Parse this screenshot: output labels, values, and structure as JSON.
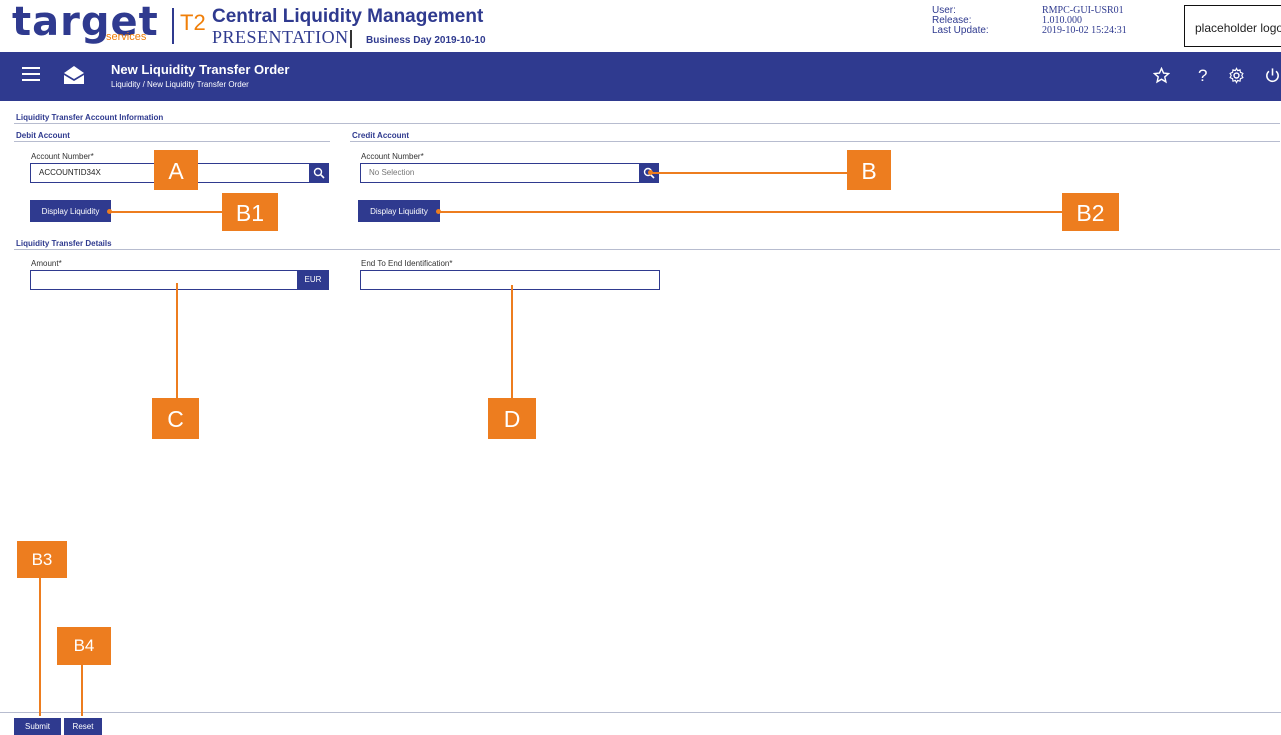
{
  "header": {
    "brand": "target",
    "brand_sub": "services",
    "system": "T2",
    "app_title": "Central Liquidity Management",
    "environment": "PRESENTATION",
    "business_day": "Business Day 2019-10-10",
    "meta": {
      "user_label": "User:",
      "user_value": "RMPC-GUI-USR01",
      "release_label": "Release:",
      "release_value": "1.010.000",
      "update_label": "Last Update:",
      "update_value": "2019-10-02 15:24:31"
    },
    "logo_placeholder": "placeholder logo"
  },
  "nav": {
    "page_title": "New Liquidity Transfer Order",
    "breadcrumb": "Liquidity  /  New Liquidity Transfer Order",
    "icons": [
      "menu-icon",
      "mail-icon",
      "star-icon",
      "help-icon",
      "gear-icon",
      "power-icon"
    ],
    "help_glyph": "?"
  },
  "account_section": {
    "title": "Liquidity Transfer Account Information",
    "debit": {
      "title": "Debit Account",
      "account_label": "Account Number*",
      "account_value": "ACCOUNTID34X",
      "display_button": "Display Liquidity"
    },
    "credit": {
      "title": "Credit Account",
      "account_label": "Account Number*",
      "account_placeholder": "No Selection",
      "display_button": "Display Liquidity"
    }
  },
  "details_section": {
    "title": "Liquidity Transfer Details",
    "amount_label": "Amount*",
    "amount_value": "",
    "currency": "EUR",
    "e2e_label": "End To End Identification*",
    "e2e_value": ""
  },
  "footer": {
    "submit": "Submit",
    "reset": "Reset"
  },
  "annotations": {
    "A": "A",
    "B": "B",
    "B1": "B1",
    "B2": "B2",
    "C": "C",
    "D": "D",
    "B3": "B3",
    "B4": "B4"
  },
  "colors": {
    "brand_blue": "#2f3a8f",
    "accent_orange": "#ed7d1f"
  }
}
